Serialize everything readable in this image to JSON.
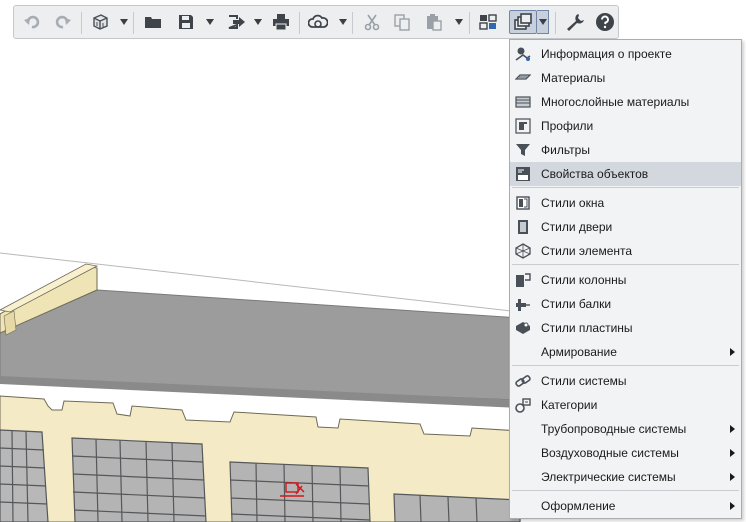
{
  "toolbar": {
    "buttons": [
      {
        "name": "undo-button",
        "icon": "undo-icon"
      },
      {
        "name": "redo-button",
        "icon": "redo-icon"
      },
      {
        "name": "3d-view-button",
        "icon": "cube-icon"
      },
      {
        "name": "open-button",
        "icon": "folder-icon"
      },
      {
        "name": "save-button",
        "icon": "save-icon"
      },
      {
        "name": "export-button",
        "icon": "export-icon"
      },
      {
        "name": "print-button",
        "icon": "printer-icon"
      },
      {
        "name": "sync-button",
        "icon": "cloud-sync-icon"
      },
      {
        "name": "cut-button",
        "icon": "scissors-icon"
      },
      {
        "name": "copy-button",
        "icon": "copy-icon"
      },
      {
        "name": "paste-button",
        "icon": "paste-icon"
      },
      {
        "name": "layout-button",
        "icon": "grid-layout-icon"
      },
      {
        "name": "attributes-button",
        "icon": "attributes-icon",
        "active": true
      },
      {
        "name": "settings-button",
        "icon": "wrench-icon"
      },
      {
        "name": "help-button",
        "icon": "help-icon"
      }
    ]
  },
  "menu": {
    "items": [
      {
        "label": "Информация о проекте",
        "icon": "project-info-icon"
      },
      {
        "label": "Материалы",
        "icon": "materials-icon"
      },
      {
        "label": "Многослойные материалы",
        "icon": "layered-materials-icon"
      },
      {
        "label": "Профили",
        "icon": "profiles-icon"
      },
      {
        "label": "Фильтры",
        "icon": "filter-icon"
      },
      {
        "label": "Свойства объектов",
        "icon": "object-properties-icon",
        "highlighted": true
      },
      {
        "label": "Стили окна",
        "icon": "window-style-icon"
      },
      {
        "label": "Стили двери",
        "icon": "door-style-icon"
      },
      {
        "label": "Стили элемента",
        "icon": "element-style-icon"
      },
      {
        "label": "Стили колонны",
        "icon": "column-style-icon"
      },
      {
        "label": "Стили балки",
        "icon": "beam-style-icon"
      },
      {
        "label": "Стили пластины",
        "icon": "plate-style-icon"
      },
      {
        "label": "Армирование",
        "icon": "",
        "submenu": true
      },
      {
        "label": "Стили системы",
        "icon": "system-style-icon"
      },
      {
        "label": "Категории",
        "icon": "categories-icon"
      },
      {
        "label": "Трубопроводные системы",
        "icon": "",
        "submenu": true
      },
      {
        "label": "Воздуховодные системы",
        "icon": "",
        "submenu": true
      },
      {
        "label": "Электрические системы",
        "icon": "",
        "submenu": true
      },
      {
        "label": "Оформление",
        "icon": "",
        "submenu": true
      }
    ]
  },
  "colors": {
    "toolbar_bg": "#eceef0",
    "menu_bg": "#f2f3f4",
    "menu_highlight": "#d3d8de",
    "wall": "#f4ebc6",
    "roof": "#9c9c9c",
    "accent_blue": "#2f67b1"
  }
}
